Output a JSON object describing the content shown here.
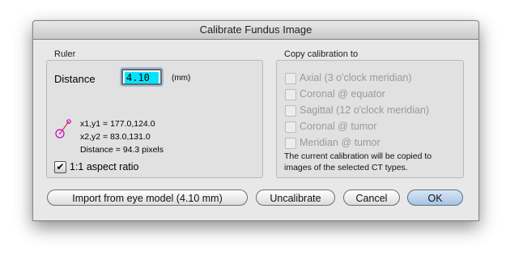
{
  "window": {
    "title": "Calibrate Fundus Image"
  },
  "ruler": {
    "group_label": "Ruler",
    "distance_label": "Distance",
    "distance_value": "4.10",
    "unit": "(mm)",
    "coords1": "x1,y1 = 177.0,124.0",
    "coords2": "x2,y2 = 83.0,131.0",
    "pixel_distance": "Distance = 94.3 pixels",
    "aspect_label": "1:1 aspect ratio",
    "aspect_checked": true
  },
  "copy": {
    "group_label": "Copy calibration to",
    "options": [
      {
        "label": "Axial (3 o'clock meridian)",
        "checked": false,
        "enabled": false
      },
      {
        "label": "Coronal @ equator",
        "checked": false,
        "enabled": false
      },
      {
        "label": "Sagittal (12 o'clock meridian)",
        "checked": false,
        "enabled": false
      },
      {
        "label": "Coronal @ tumor",
        "checked": false,
        "enabled": false
      },
      {
        "label": "Meridian @ tumor",
        "checked": false,
        "enabled": false
      }
    ],
    "note_line1": "The current calibration will be copied to",
    "note_line2": "images of the selected CT types."
  },
  "buttons": {
    "import": "Import from eye model (4.10 mm)",
    "uncalibrate": "Uncalibrate",
    "cancel": "Cancel",
    "ok": "OK"
  },
  "icons": {
    "ruler": "ruler-icon",
    "check": "checkmark-icon"
  },
  "colors": {
    "input_highlight": "#00e5ff",
    "ruler_endpoint": "#cc00cc",
    "ruler_line": "#d9002e",
    "default_button": "#a6c3e3"
  }
}
